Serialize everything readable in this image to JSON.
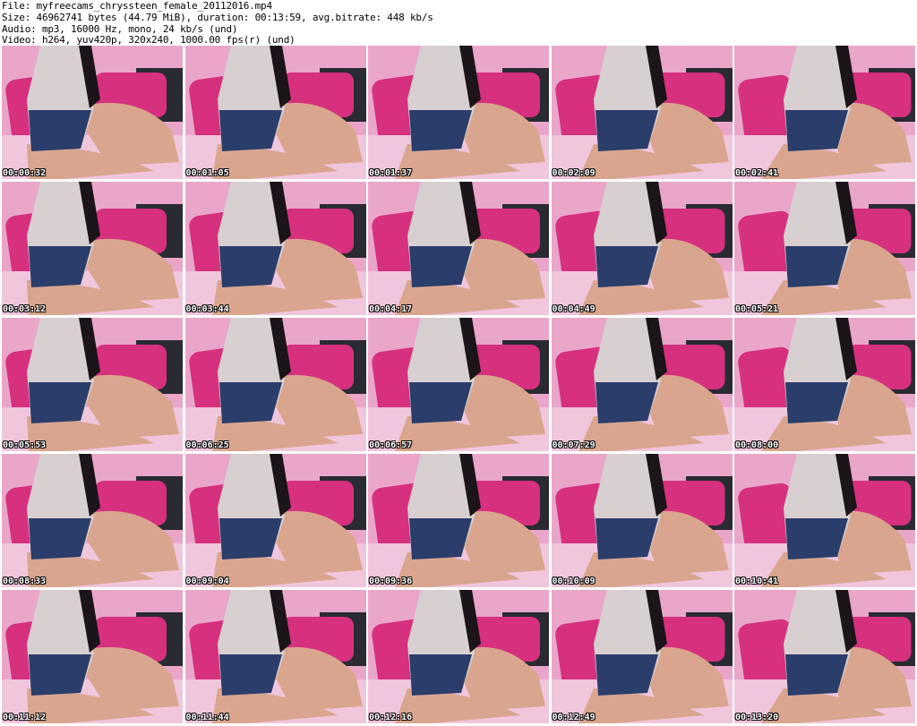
{
  "header": {
    "file": "File: myfreecams_chryssteen_female_20112016.mp4",
    "size": "Size: 46962741 bytes (44.79 MiB), duration: 00:13:59, avg.bitrate: 448 kb/s",
    "audio": "Audio: mp3, 16000 Hz, mono, 24 kb/s (und)",
    "video": "Video: h264, yuv420p, 320x240, 1000.00 fps(r) (und)"
  },
  "thumbnails": [
    {
      "time": "00:00:32"
    },
    {
      "time": "00:01:05"
    },
    {
      "time": "00:01:37"
    },
    {
      "time": "00:02:09"
    },
    {
      "time": "00:02:41"
    },
    {
      "time": "00:03:12"
    },
    {
      "time": "00:03:44"
    },
    {
      "time": "00:04:17"
    },
    {
      "time": "00:04:49"
    },
    {
      "time": "00:05:21"
    },
    {
      "time": "00:05:53"
    },
    {
      "time": "00:06:25"
    },
    {
      "time": "00:06:57"
    },
    {
      "time": "00:07:29"
    },
    {
      "time": "00:08:00"
    },
    {
      "time": "00:08:33"
    },
    {
      "time": "00:09:04"
    },
    {
      "time": "00:09:36"
    },
    {
      "time": "00:10:09"
    },
    {
      "time": "00:10:41"
    },
    {
      "time": "00:11:12"
    },
    {
      "time": "00:11:44"
    },
    {
      "time": "00:12:16"
    },
    {
      "time": "00:12:49"
    },
    {
      "time": "00:13:20"
    }
  ],
  "colors": {
    "wall": "#e9a6c9",
    "pillow": "#d6307f",
    "couch": "#2a2a33",
    "blanket": "#f0c6dd",
    "skin": "#d9a58e",
    "top_light": "#d8cfd0",
    "top_dark": "#2b3d6b",
    "hair": "#1b1418"
  }
}
